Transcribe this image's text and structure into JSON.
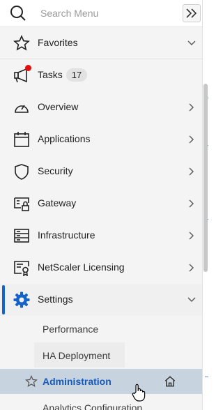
{
  "search": {
    "placeholder": "Search Menu"
  },
  "favorites": {
    "label": "Favorites"
  },
  "menu_items": [
    {
      "label": "Tasks",
      "badge": "17",
      "icon": "megaphone-icon"
    },
    {
      "label": "Overview",
      "icon": "gauge-icon"
    },
    {
      "label": "Applications",
      "icon": "calendar-icon"
    },
    {
      "label": "Security",
      "icon": "shield-icon"
    },
    {
      "label": "Gateway",
      "icon": "gateway-lock-icon"
    },
    {
      "label": "Infrastructure",
      "icon": "server-icon"
    },
    {
      "label": "NetScaler Licensing",
      "icon": "license-certificate-icon"
    },
    {
      "label": "Settings",
      "icon": "gear-icon"
    }
  ],
  "settings_submenu": [
    {
      "label": "Performance"
    },
    {
      "label": "HA Deployment"
    },
    {
      "label": "Administration",
      "selected": true
    },
    {
      "label": "Analytics Configuration"
    }
  ],
  "colors": {
    "accent": "#1563c9",
    "selected_bg": "#c8d3e0",
    "notification": "#e30e0e"
  }
}
